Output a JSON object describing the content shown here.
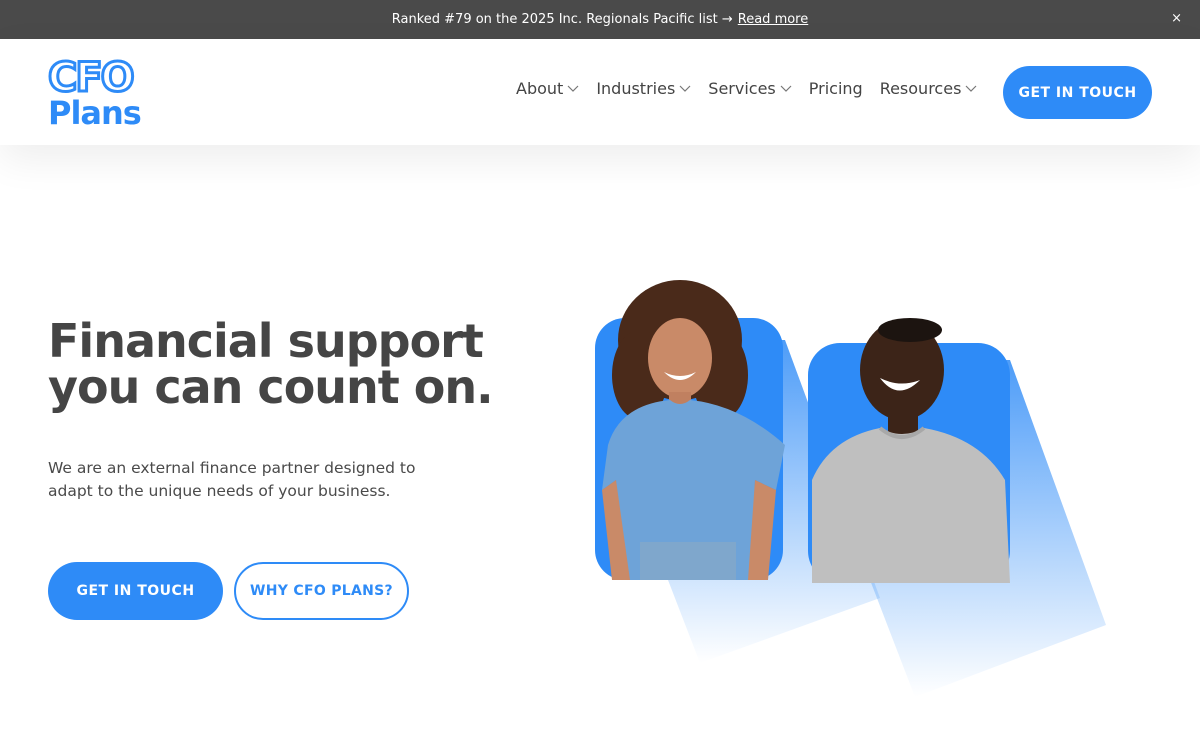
{
  "announcement": {
    "text": "Ranked #79 on the 2025 Inc. Regionals Pacific list →",
    "link": "Read more",
    "close": "×"
  },
  "header": {
    "logo": {
      "line1": "CFO",
      "line2": "Plans",
      "color": "#2e8bf7"
    },
    "nav": [
      {
        "label": "About",
        "dropdown": true
      },
      {
        "label": "Industries",
        "dropdown": true
      },
      {
        "label": "Services",
        "dropdown": true
      },
      {
        "label": "Pricing",
        "dropdown": false
      },
      {
        "label": "Resources",
        "dropdown": true
      }
    ],
    "cta": "GET IN TOUCH"
  },
  "hero": {
    "title_line1": "Financial support",
    "title_line2": "you can count on.",
    "subtitle_line1": "We are an external finance partner designed to",
    "subtitle_line2": "adapt to the unique needs of your business.",
    "primary_cta": "GET IN TOUCH",
    "secondary_cta": "WHY CFO PLANS?"
  },
  "colors": {
    "accent": "#2e8bf7",
    "announcement_bg": "#4a4a4a",
    "heading": "#454545"
  }
}
